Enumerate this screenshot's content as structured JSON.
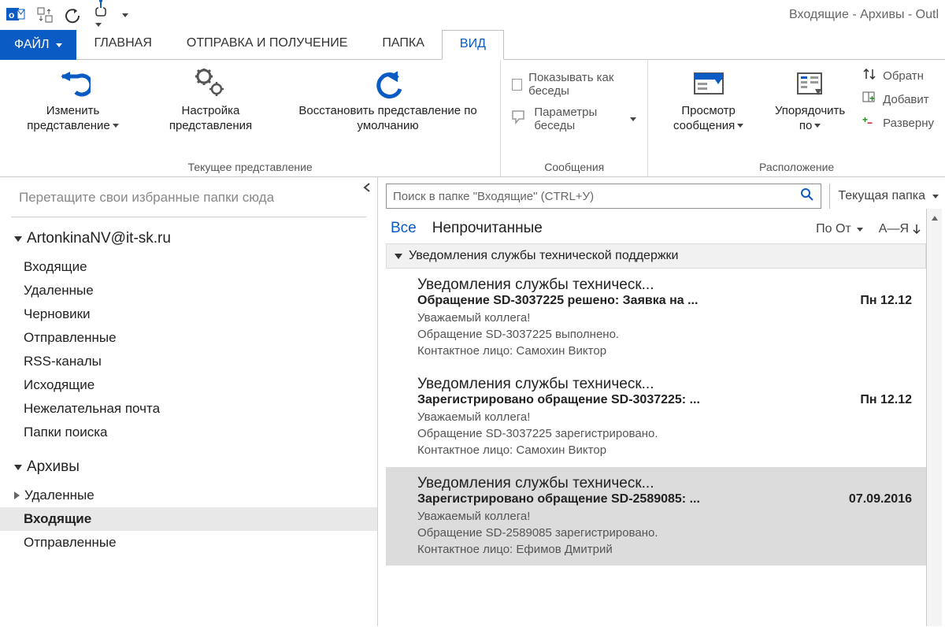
{
  "window_title": "Входящие - Архивы - Outl",
  "tabs": {
    "file": "ФАЙЛ",
    "home": "ГЛАВНАЯ",
    "sendreceive": "ОТПРАВКА И ПОЛУЧЕНИЕ",
    "folder": "ПАПКА",
    "view": "ВИД"
  },
  "ribbon": {
    "group_currentview": {
      "label": "Текущее представление",
      "change_view": "Изменить представление",
      "view_settings": "Настройка представления",
      "reset_view": "Восстановить представление по умолчанию"
    },
    "group_messages": {
      "label": "Сообщения",
      "show_as_conv": "Показывать как беседы",
      "conv_settings": "Параметры беседы"
    },
    "group_arrangement": {
      "label": "Расположение",
      "preview": "Просмотр сообщения",
      "arrange_by": "Упорядочить по",
      "reverse_sort": "Обратн",
      "add_columns": "Добавит",
      "expand_collapse": "Разверну"
    }
  },
  "nav": {
    "favorites_hint": "Перетащите свои избранные папки сюда",
    "account": "ArtonkinaNV@it-sk.ru",
    "folders": {
      "inbox": "Входящие",
      "deleted": "Удаленные",
      "drafts": "Черновики",
      "sent": "Отправленные",
      "rss": "RSS-каналы",
      "outbox": "Исходящие",
      "junk": "Нежелательная почта",
      "search": "Папки поиска"
    },
    "archives_header": "Архивы",
    "archives": {
      "deleted": "Удаленные",
      "inbox": "Входящие",
      "sent": "Отправленные"
    }
  },
  "search": {
    "placeholder": "Поиск в папке \"Входящие\" (CTRL+У)",
    "scope": "Текущая папка"
  },
  "filter": {
    "all": "Все",
    "unread": "Непрочитанные",
    "by_from": "По От",
    "az": "А—Я"
  },
  "group_header": "Уведомления службы технической поддержки",
  "messages": [
    {
      "from": "Уведомления службы техническ...",
      "subject": "Обращение SD-3037225 решено: Заявка на ...",
      "date": "Пн 12.12",
      "line1": "Уважаемый коллега!",
      "line2": "Обращение SD-3037225 выполнено.",
      "line3": "Контактное лицо: Самохин Виктор"
    },
    {
      "from": "Уведомления службы техническ...",
      "subject": "Зарегистрировано обращение SD-3037225: ...",
      "date": "Пн 12.12",
      "line1": "Уважаемый коллега!",
      "line2": "Обращение SD-3037225 зарегистрировано.",
      "line3": "Контактное лицо: Самохин Виктор"
    },
    {
      "from": "Уведомления службы техническ...",
      "subject": "Зарегистрировано обращение SD-2589085: ...",
      "date": "07.09.2016",
      "line1": "Уважаемый коллега!",
      "line2": "Обращение SD-2589085 зарегистрировано.",
      "line3": "Контактное лицо: Ефимов Дмитрий"
    }
  ]
}
